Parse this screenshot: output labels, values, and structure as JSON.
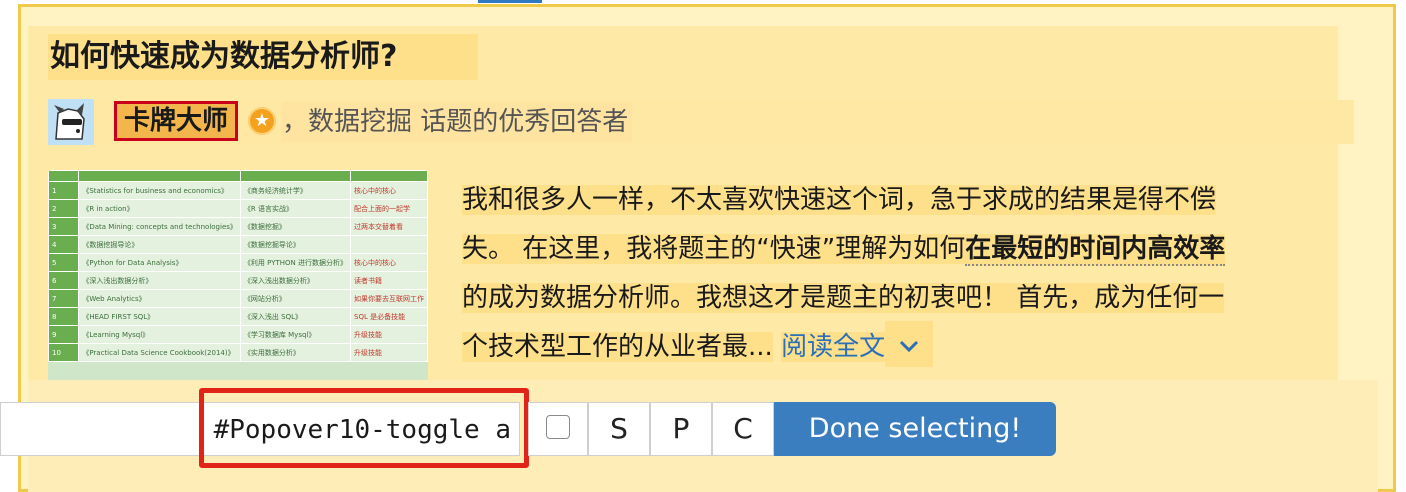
{
  "question": {
    "title": "如何快速成为数据分析师?"
  },
  "author": {
    "name": "卡牌大师",
    "badge_icon": "star-badge-icon",
    "description": "，数据挖掘 话题的优秀回答者"
  },
  "answer": {
    "line1": "我和很多人一样，不太喜欢快速这个词，急于求成的结果是得不偿",
    "line2_a": "失。 在这里，我将题主的“快速”理解为如何",
    "line2_b": "在最短的时间内高效率",
    "line3": "的成为数据分析师。我想这才是题主的初衷吧！ 首先，成为任何一",
    "line4": "个技术型工作的从业者最...",
    "read_more": "阅读全文"
  },
  "thumbnail_table": [
    [
      "",
      "",
      "",
      ""
    ],
    [
      "1",
      "《Statistics for business and economics》",
      "《商务经济统计学》",
      "核心中的核心"
    ],
    [
      "2",
      "《R in action》",
      "《R 语言实战》",
      "配合上面的一起学"
    ],
    [
      "3",
      "《Data Mining: concepts and technologies》",
      "《数据挖掘》",
      "过两本交替着看"
    ],
    [
      "4",
      "《数据挖掘导论》",
      "《数据挖掘导论》",
      ""
    ],
    [
      "5",
      "《Python for Data Analysis》",
      "《利用 PYTHON 进行数据分析》",
      "核心中的核心"
    ],
    [
      "6",
      "《深入浅出数据分析》",
      "《深入浅出数据分析》",
      "读者书籍"
    ],
    [
      "7",
      "《Web Analytics》",
      "《网站分析》",
      "如果你要去互联网工作"
    ],
    [
      "8",
      "《HEAD FIRST SQL》",
      "《深入浅出 SQL》",
      "SQL 是必备技能"
    ],
    [
      "9",
      "《Learning Mysql》",
      "《学习数据库 Mysql》",
      "升级技能"
    ],
    [
      "10",
      "《Practical Data Science Cookbook(2014)》",
      "《实用数据分析》",
      "升级技能"
    ]
  ],
  "toolbar": {
    "selector_value": "#Popover10-toggle a",
    "btn_s": "S",
    "btn_p": "P",
    "btn_c": "C",
    "done_label": "Done selecting!"
  },
  "colors": {
    "highlight_outline": "#e22418",
    "done_button": "#3a7ec0",
    "link": "#2a6fb8"
  }
}
